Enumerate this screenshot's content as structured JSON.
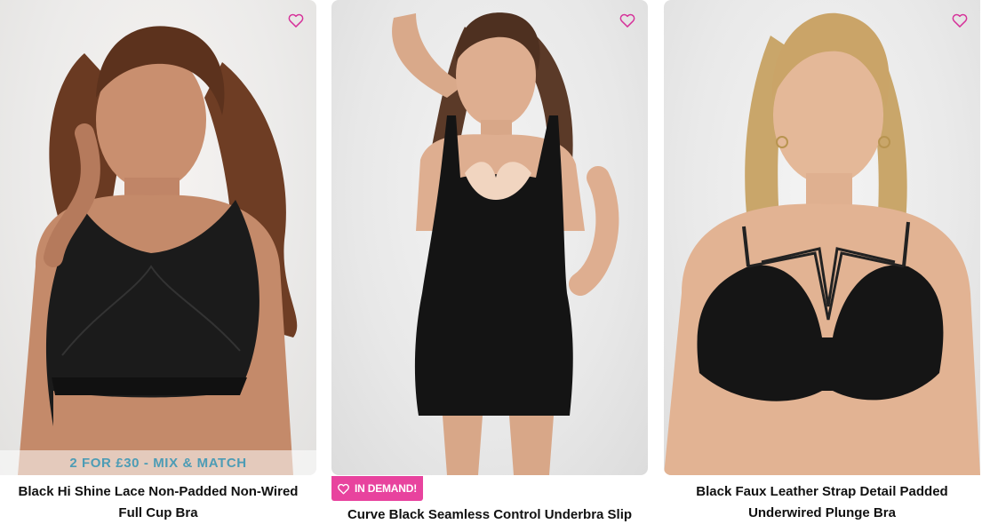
{
  "products": [
    {
      "title": "Black Hi Shine Lace Non-Padded Non-Wired Full Cup Bra",
      "promo": "2 FOR £30 - MIX & MATCH",
      "wishlist_icon": "heart-outline-icon"
    },
    {
      "title": "Curve Black Seamless Control Underbra Slip Dress",
      "badge": "IN DEMAND!",
      "wishlist_icon": "heart-outline-icon"
    },
    {
      "title": "Black Faux Leather Strap Detail Padded Underwired Plunge Bra",
      "wishlist_icon": "heart-outline-icon"
    }
  ],
  "colors": {
    "wishlist_heart": "#d6339a",
    "badge_bg": "#e8439e",
    "promo_text": "#4d9cb5"
  }
}
